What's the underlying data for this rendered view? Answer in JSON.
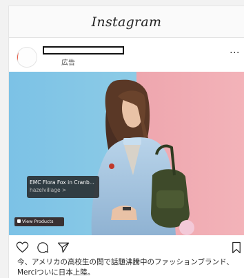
{
  "app": {
    "logo_text": "Instagram"
  },
  "post": {
    "sponsored_label": "広告",
    "more_label": "···",
    "product_tag": {
      "name": "EMC Flora Fox in Cranb...",
      "store": "hazelvillage >"
    },
    "view_products_label": "View Products",
    "caption": "今、アメリカの高校生の間で話題沸騰中のファッションブランド、Merciついに日本上陸。"
  },
  "icons": {
    "like": "heart-icon",
    "comment": "comment-icon",
    "share": "send-icon",
    "save": "bookmark-icon"
  },
  "colors": {
    "background_left": "#7fc3e4",
    "background_right": "#f0a8b0",
    "avatar_ring": "#e8553e"
  }
}
